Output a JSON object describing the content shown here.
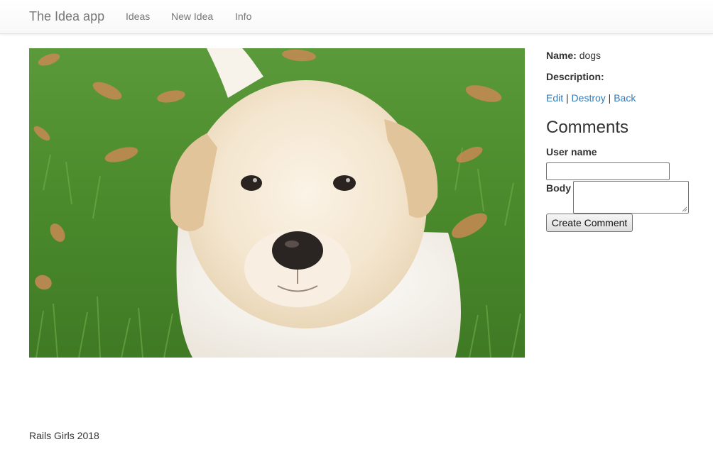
{
  "navbar": {
    "brand": "The Idea app",
    "links": [
      {
        "label": "Ideas"
      },
      {
        "label": "New Idea"
      },
      {
        "label": "Info"
      }
    ]
  },
  "idea": {
    "name_label": "Name:",
    "name_value": "dogs",
    "description_label": "Description:",
    "description_value": "",
    "picture": "puppy-photo"
  },
  "actions": {
    "edit": "Edit",
    "separator1": "|",
    "destroy": "Destroy",
    "separator2": "|",
    "back": "Back"
  },
  "comments": {
    "heading": "Comments",
    "user_name_label": "User name",
    "user_name_value": "",
    "body_label": "Body",
    "body_value": "",
    "submit_label": "Create Comment"
  },
  "footer": {
    "text": "Rails Girls 2018"
  }
}
